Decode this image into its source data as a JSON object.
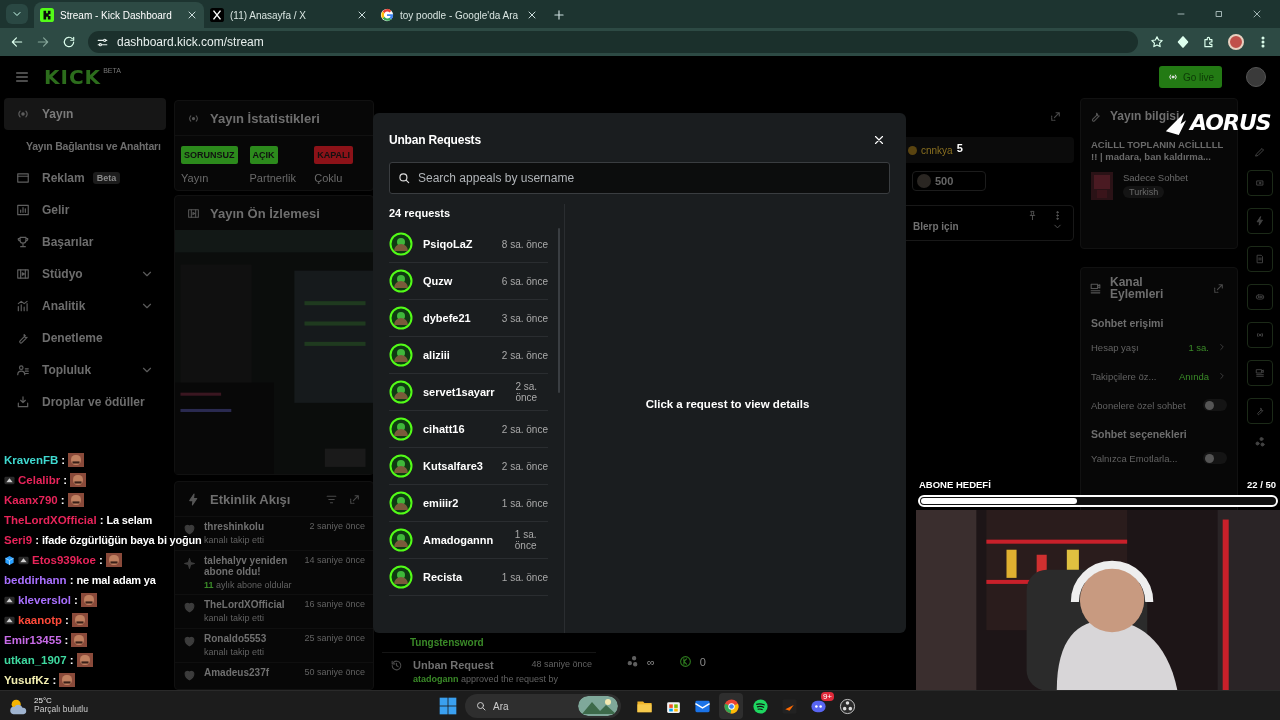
{
  "browser": {
    "tabs": [
      {
        "title": "Stream - Kick Dashboard",
        "kind": "kick",
        "selected": true
      },
      {
        "title": "(11) Anasayfa / X",
        "kind": "x",
        "selected": false
      },
      {
        "title": "toy poodle - Google'da Ara",
        "kind": "google",
        "selected": false
      }
    ],
    "address": "dashboard.kick.com/stream"
  },
  "header": {
    "logo": "KICK",
    "logo_badge": "BETA",
    "go_live": "Go live"
  },
  "sidebar": {
    "items": [
      {
        "label": "Yayın",
        "kind": "live",
        "selected": true
      },
      {
        "label": "Yayın Bağlantısı ve Anahtarı",
        "selected": false
      },
      {
        "label": "Reklam",
        "kind": "ad",
        "badge": "Beta",
        "selected": false
      },
      {
        "label": "Gelir",
        "kind": "revenue",
        "selected": false
      },
      {
        "label": "Başarılar",
        "kind": "trophy",
        "selected": false
      },
      {
        "label": "Stüdyo",
        "kind": "studio",
        "selected": false,
        "expanded": false
      },
      {
        "label": "Analitik",
        "kind": "analytics",
        "selected": false,
        "expanded": false
      },
      {
        "label": "Denetleme",
        "kind": "wrench",
        "selected": false
      },
      {
        "label": "Topluluk",
        "kind": "community",
        "selected": false,
        "expanded": false
      },
      {
        "label": "Droplar ve ödüller",
        "kind": "drops",
        "selected": false
      }
    ]
  },
  "stats": {
    "title": "Yayın İstatistikleri",
    "items": [
      {
        "status": "SORUNSUZ",
        "label": "Yayın",
        "color": "#2c8a1c"
      },
      {
        "status": "AÇIK",
        "label": "Partnerlik",
        "color": "#2c8a1c"
      },
      {
        "status": "KAPALI",
        "label": "Çoklu",
        "color": "#8c1218"
      }
    ]
  },
  "preview": {
    "title": "Yayın Ön İzlemesi"
  },
  "activity": {
    "title": "Etkinlik Akışı",
    "events": [
      {
        "kind": "follow",
        "user": "threshinkolu",
        "detail": "kanalı takip etti",
        "time": "2 saniye önce"
      },
      {
        "kind": "resub",
        "user": "talehalyv yeniden abone oldu!",
        "count": "11",
        "detail": "aylık abone oldular",
        "time": "14 saniye önce"
      },
      {
        "kind": "follow",
        "user": "TheLordXOfficial",
        "detail": "kanalı takip etti",
        "time": "16 saniye önce"
      },
      {
        "kind": "follow",
        "user": "Ronaldo5553",
        "detail": "kanalı takip etti",
        "time": "25 saniye önce"
      },
      {
        "kind": "follow",
        "user": "Amadeus237f",
        "time": "50 saniye önce"
      }
    ]
  },
  "mod_log": [
    {
      "kind": "user",
      "text": "Tungstensword"
    },
    {
      "kind": "unban",
      "title": "Unban Request",
      "time": "48 saniye önce",
      "actor": "atadogann",
      "detail": "approved the request by"
    }
  ],
  "chat_panel": {
    "mention_user": "cnnkya",
    "mention_count": "5",
    "amount": "500",
    "blerp": "Blerp için",
    "stats": [
      {
        "kind": "people",
        "value": "∞"
      },
      {
        "kind": "kick",
        "value": "0"
      }
    ]
  },
  "stream_info": {
    "title": "Yayın bilgisi",
    "stream_title": "ACİLLL TOPLANIN ACİLLLLL !! | madara, ban kaldırma...",
    "category": "Sadece Sohbet",
    "tag": "Turkish"
  },
  "channel_actions": {
    "title": "Kanal Eylemleri",
    "sections": [
      {
        "heading": "Sohbet erişimi",
        "rows": [
          {
            "kind": "link",
            "label": "Hesap yaşı",
            "value": "1 sa."
          },
          {
            "kind": "link",
            "label": "Takipçilere öz...",
            "value": "Anında"
          },
          {
            "kind": "toggle",
            "label": "Abonelere özel sohbet",
            "on": false
          }
        ]
      },
      {
        "heading": "Sohbet seçenekleri",
        "rows": [
          {
            "kind": "toggle",
            "label": "Yalnızca Emotlarla...",
            "on": false
          }
        ]
      }
    ]
  },
  "modal": {
    "title": "Unban Requests",
    "search_placeholder": "Search appeals by username",
    "count": "24 requests",
    "empty_message": "Click a request to view details",
    "requests": [
      {
        "user": "PsiqoLaZ",
        "time": "8 sa. önce",
        "selected": false
      },
      {
        "user": "Quzw",
        "time": "6 sa. önce",
        "selected": false
      },
      {
        "user": "dybefe21",
        "time": "3 sa. önce",
        "selected": false
      },
      {
        "user": "aliziii",
        "time": "2 sa. önce",
        "selected": false
      },
      {
        "user": "servet1sayarr",
        "time": "2 sa. önce",
        "selected": false
      },
      {
        "user": "cihatt16",
        "time": "2 sa. önce",
        "selected": false
      },
      {
        "user": "Kutsalfare3",
        "time": "2 sa. önce",
        "selected": false
      },
      {
        "user": "emiiir2",
        "time": "1 sa. önce",
        "selected": false
      },
      {
        "user": "Amadogannn",
        "time": "1 sa. önce",
        "selected": false
      },
      {
        "user": "Recista",
        "time": "1 sa. önce",
        "selected": false
      }
    ]
  },
  "overlay": {
    "logo": "AORUS",
    "chat": [
      {
        "user": "KravenFB",
        "color": "#3fd9d0",
        "separator": ":",
        "kind": "emote"
      },
      {
        "user": "Celalibr",
        "color": "#e8245a",
        "badges": [
          {
            "kind": "sub"
          }
        ],
        "separator": ":",
        "kind": "emote"
      },
      {
        "user": "Kaanx790",
        "color": "#e8245a",
        "separator": ":",
        "kind": "emote"
      },
      {
        "user": "TheLordXOfficial",
        "color": "#e8245a",
        "separator": ":",
        "kind": "text",
        "message": "La selam"
      },
      {
        "user": "Seri9",
        "color": "#e8245a",
        "separator": ":",
        "kind": "text",
        "message": "ifade özgürlüğün baya bi yoğun"
      },
      {
        "user": "Etos939koe",
        "color": "#e8245a",
        "badges": [
          {
            "kind": "gem"
          },
          {
            "kind": "sub"
          }
        ],
        "separator": ":",
        "kind": "emote"
      },
      {
        "user": "beddirhann",
        "color": "#a970ff",
        "separator": ":",
        "kind": "text",
        "message": "ne mal adam ya"
      },
      {
        "user": "kleverslol",
        "color": "#a970ff",
        "badges": [
          {
            "kind": "sub"
          }
        ],
        "separator": ":",
        "kind": "emote"
      },
      {
        "user": "kaanotp",
        "color": "#ff4a3a",
        "badges": [
          {
            "kind": "sub"
          }
        ],
        "separator": ":",
        "kind": "emote"
      },
      {
        "user": "Emir13455",
        "color": "#c86be8",
        "separator": ":",
        "kind": "emote"
      },
      {
        "user": "utkan_1907",
        "color": "#3fd9a0",
        "separator": ":",
        "kind": "emote"
      },
      {
        "user": "YusufKz",
        "color": "#f3eeb0",
        "separator": ":",
        "kind": "emote"
      }
    ],
    "sub_goal": {
      "label": "ABONE HEDEFİ",
      "count": "22 / 50",
      "level": 0.44
    }
  },
  "taskbar": {
    "weather": {
      "temp": "25°C",
      "text": "Parçalı bulutlu"
    },
    "search": "Ara",
    "apps": [
      {
        "kind": "folder",
        "active": false
      },
      {
        "kind": "store",
        "active": false
      },
      {
        "kind": "mail",
        "active": false
      },
      {
        "kind": "chrome",
        "active": true
      },
      {
        "kind": "spotify",
        "active": false
      },
      {
        "kind": "editor",
        "active": false
      },
      {
        "kind": "discord",
        "active": false,
        "badge": "9+"
      },
      {
        "kind": "recorder",
        "active": false
      }
    ]
  }
}
